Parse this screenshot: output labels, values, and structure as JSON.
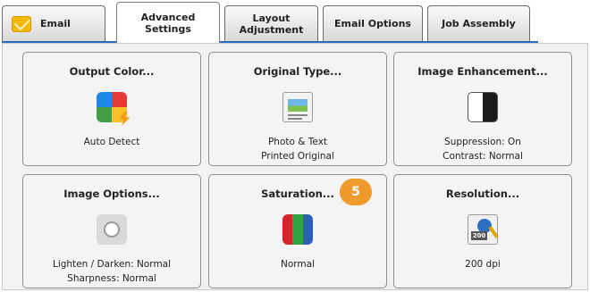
{
  "tabs": [
    {
      "label": "Email",
      "icon": "mail-icon",
      "active": false
    },
    {
      "label": "Advanced\nSettings",
      "active": true
    },
    {
      "label": "Layout\nAdjustment",
      "active": false
    },
    {
      "label": "Email Options",
      "active": false
    },
    {
      "label": "Job Assembly",
      "active": false
    }
  ],
  "tiles": [
    {
      "title": "Output Color...",
      "value": "Auto Detect",
      "icon": "output-color-icon"
    },
    {
      "title": "Original Type...",
      "value": "Photo & Text\nPrinted Original",
      "icon": "photo-text-icon"
    },
    {
      "title": "Image Enhancement...",
      "value": "Suppression: On\nContrast: Normal",
      "icon": "image-enhancement-icon"
    },
    {
      "title": "Image Options...",
      "value": "Lighten / Darken: Normal\nSharpness: Normal",
      "icon": "brightness-icon"
    },
    {
      "title": "Saturation...",
      "value": "Normal",
      "icon": "saturation-icon"
    },
    {
      "title": "Resolution...",
      "value": "200 dpi",
      "icon": "resolution-icon",
      "icon_tag": "200"
    }
  ],
  "badge": {
    "value": "5"
  },
  "colors": {
    "accent": "#2c6cbf",
    "badge": "#ee9a2c",
    "saturation_red": "#d8232a",
    "saturation_green": "#2fa341",
    "saturation_blue": "#2a5fc0"
  }
}
